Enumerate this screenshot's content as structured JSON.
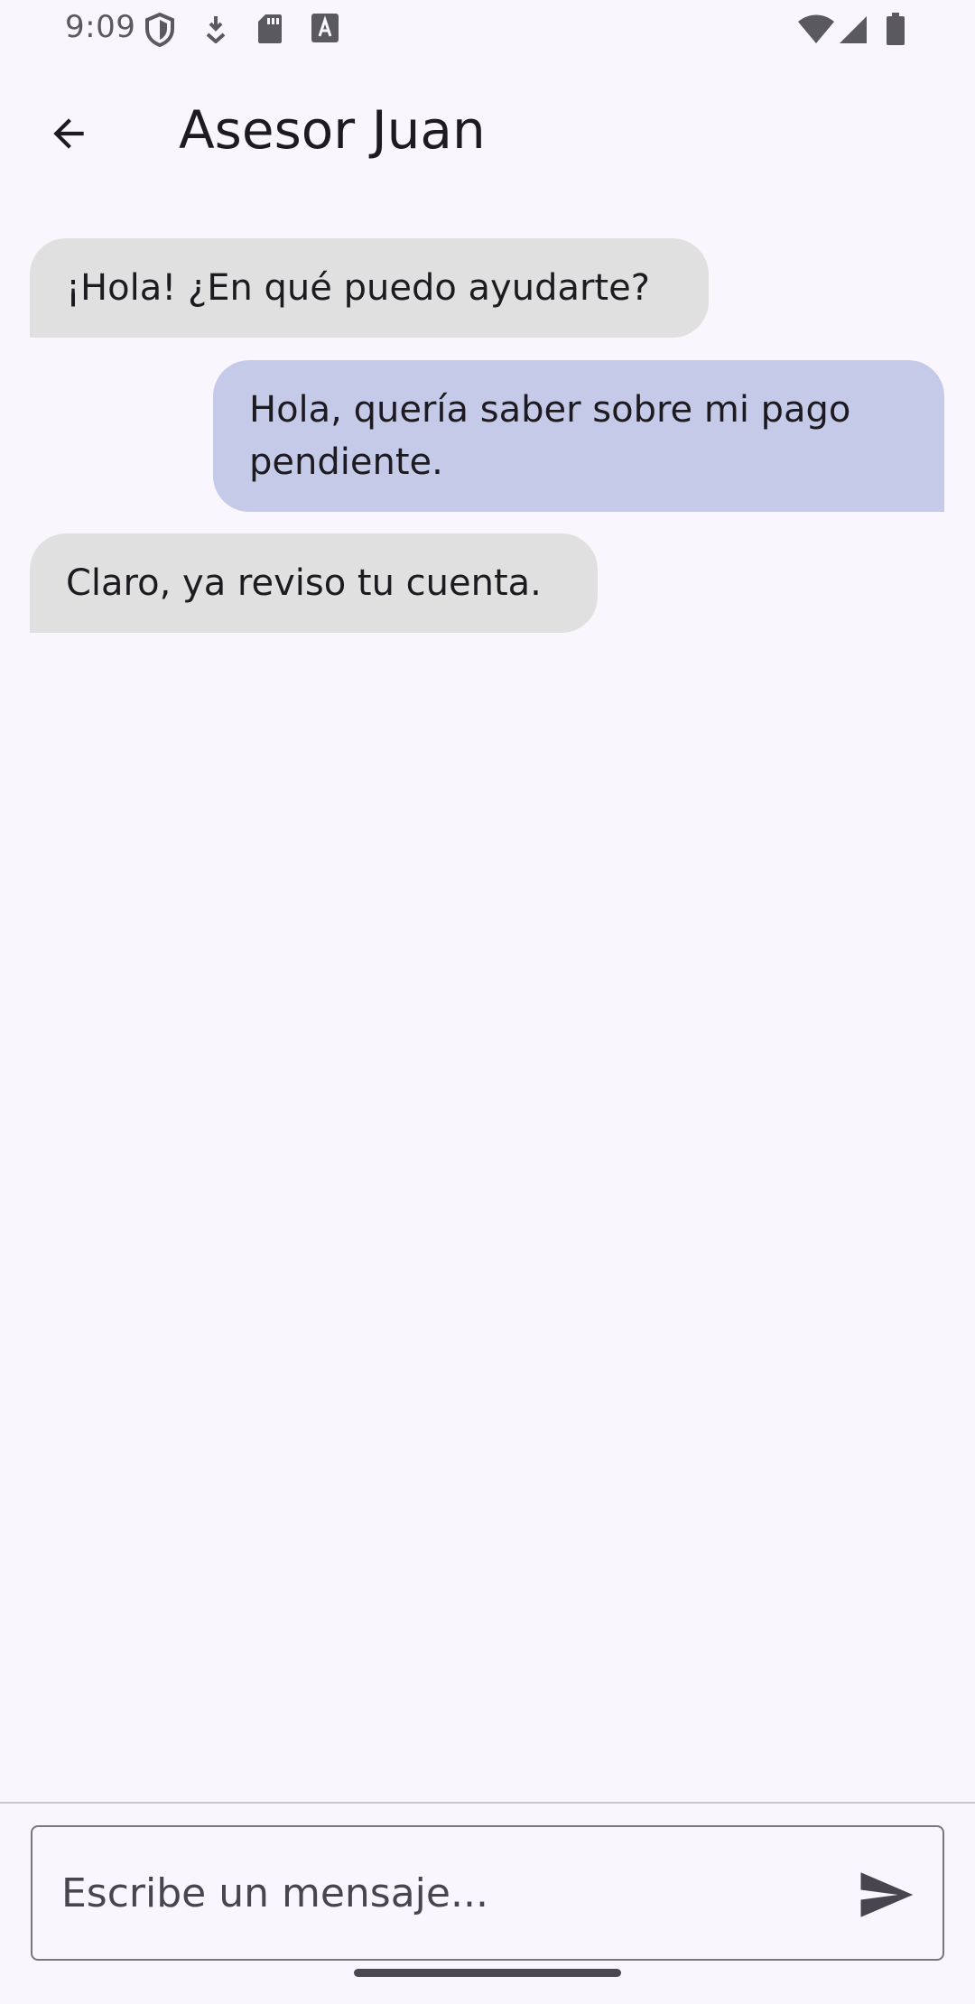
{
  "status_bar": {
    "time": "9:09",
    "icons": [
      "shield-icon",
      "download-icon",
      "sd-card-icon",
      "font-a-icon",
      "wifi-icon",
      "signal-icon",
      "battery-icon"
    ]
  },
  "app_bar": {
    "title": "Asesor Juan",
    "back_icon": "arrow-back-icon"
  },
  "messages": [
    {
      "sender": "advisor",
      "text": "¡Hola! ¿En qué puedo ayudarte?"
    },
    {
      "sender": "user",
      "text": "Hola, quería saber sobre mi pago pendiente."
    },
    {
      "sender": "advisor",
      "text": "Claro, ya reviso tu cuenta."
    }
  ],
  "composer": {
    "placeholder": "Escribe un mensaje...",
    "value": "",
    "send_icon": "send-icon"
  },
  "colors": {
    "background": "#f9f6fd",
    "incoming_bubble": "#e0e0e0",
    "outgoing_bubble": "#c5cae9"
  }
}
